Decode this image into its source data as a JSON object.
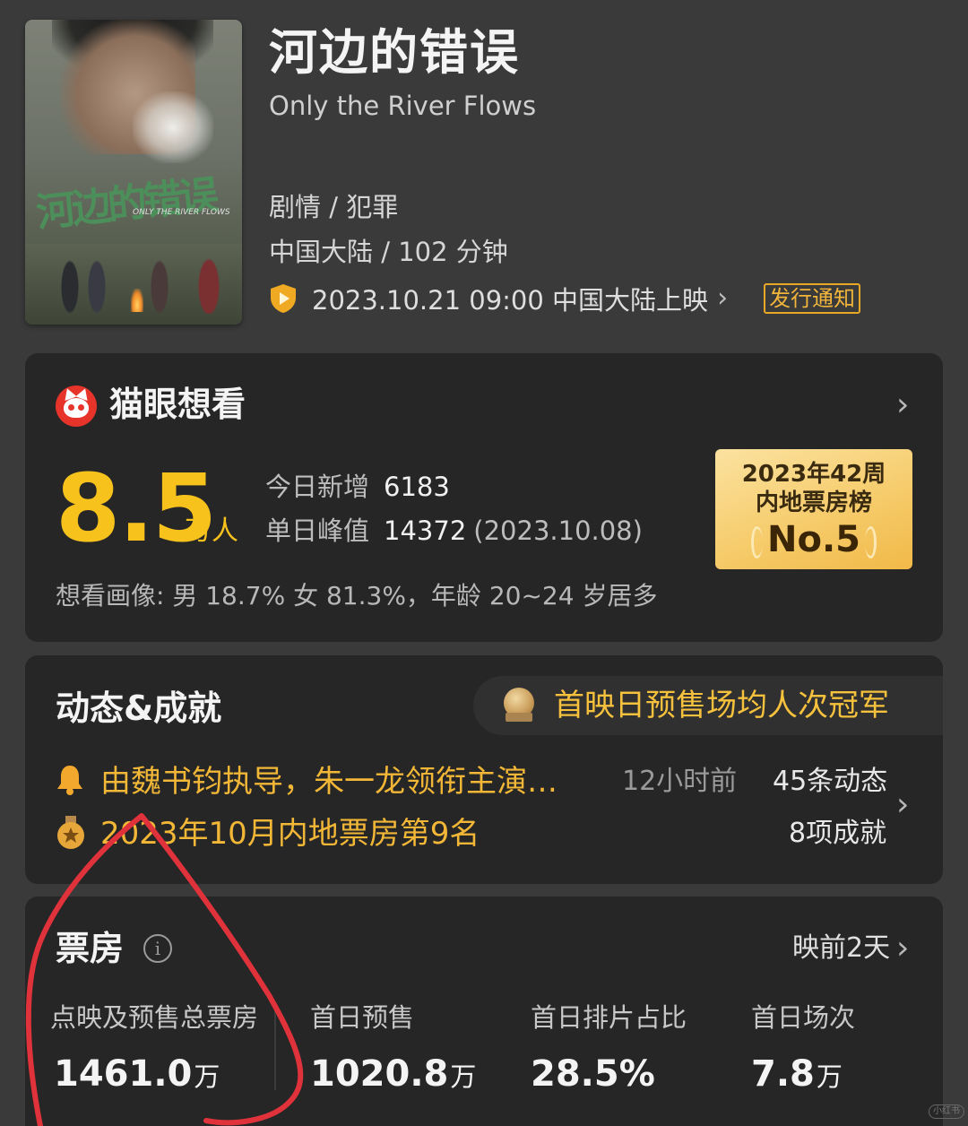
{
  "movie": {
    "title": "河边的错误",
    "subtitle": "Only the River Flows",
    "poster_title_art": "河边的错误",
    "poster_title_en": "ONLY THE RIVER FLOWS",
    "genre": "剧情 / 犯罪",
    "region_duration": "中国大陆 / 102 分钟",
    "release": "2023.10.21 09:00 中国大陆上映",
    "release_notice_label": "发行通知"
  },
  "want_card": {
    "title": "猫眼想看",
    "count": "8.5",
    "count_unit": "万人",
    "today_new_label": "今日新增",
    "today_new_value": "6183",
    "peak_label": "单日峰值",
    "peak_value": "14372",
    "peak_date": "(2023.10.08)",
    "rank_line1": "2023年42周",
    "rank_line2": "内地票房榜",
    "rank_value": "No.5",
    "portrait": "想看画像: 男 18.7%  女 81.3%，年龄 20~24 岁居多"
  },
  "dynamics_card": {
    "title": "动态&成就",
    "achievement_highlight": "首映日预售场均人次冠军",
    "news_text": "由魏书钧执导，朱一龙领衔主演…",
    "news_time": "12小时前",
    "news_count": "45条动态",
    "achievement_text": "2023年10月内地票房第9名",
    "achievement_count": "8项成就"
  },
  "box_office_card": {
    "title": "票房",
    "info_icon_glyph": "i",
    "presale_days": "映前2天",
    "metrics": [
      {
        "label": "点映及预售总票房",
        "value": "1461.0",
        "unit": "万"
      },
      {
        "label": "首日预售",
        "value": "1020.8",
        "unit": "万"
      },
      {
        "label": "首日排片占比",
        "value": "28.5%",
        "unit": ""
      },
      {
        "label": "首日场次",
        "value": "7.8",
        "unit": "万"
      }
    ]
  },
  "icons": {
    "release": "shield-play-icon",
    "maoyan": "maoyan-cat-icon",
    "achievement": "medal-icon",
    "news": "bell-icon",
    "info": "info-icon",
    "chevron": "chevron-right-icon"
  },
  "colors": {
    "background": "#3a3a3a",
    "card": "#262626",
    "accent_yellow": "#f7c21c",
    "news_orange": "#f2b737",
    "annotation_red": "#e0323a"
  },
  "watermark": "小红书"
}
